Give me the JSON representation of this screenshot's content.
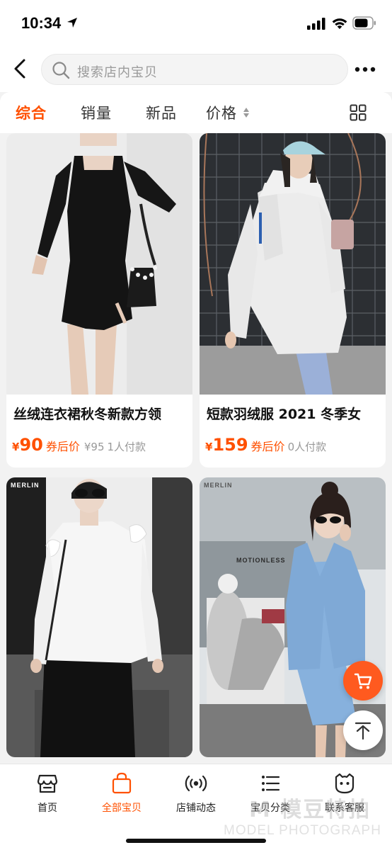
{
  "status_bar": {
    "time": "10:34",
    "icons": [
      "location-arrow-icon",
      "signal-icon",
      "wifi-icon",
      "battery-icon"
    ]
  },
  "top_nav": {
    "back_icon": "chevron-left-icon",
    "search_placeholder": "搜索店内宝贝",
    "search_icon": "search-icon",
    "more_icon": "more-dots-icon"
  },
  "filter_tabs": [
    {
      "label": "综合",
      "active": true
    },
    {
      "label": "销量",
      "active": false
    },
    {
      "label": "新品",
      "active": false
    },
    {
      "label": "价格",
      "active": false,
      "icon": "sort-arrows-icon"
    }
  ],
  "layout_toggle_icon": "grid-view-icon",
  "products": [
    {
      "title": "丝绒连衣裙秋冬新款方领",
      "currency": "¥",
      "price": "90",
      "coupon_label": "券后价",
      "original_price": "¥95",
      "sales": "1人付款"
    },
    {
      "title": "短款羽绒服 2021 冬季女",
      "currency": "¥",
      "price": "159",
      "coupon_label": "券后价",
      "sales": "0人付款"
    },
    {
      "brand_tag": "MERLIN"
    },
    {
      "brand_tag": "MERLIN",
      "scene_text": "MOTIONLESS"
    }
  ],
  "floating_buttons": {
    "cart_icon": "cart-icon",
    "top_icon": "back-to-top-icon"
  },
  "bottom_nav": [
    {
      "label": "首页",
      "icon": "store-home-icon",
      "active": false
    },
    {
      "label": "全部宝贝",
      "icon": "shopping-bag-icon",
      "active": true
    },
    {
      "label": "店铺动态",
      "icon": "broadcast-icon",
      "active": false
    },
    {
      "label": "宝贝分类",
      "icon": "list-icon",
      "active": false
    },
    {
      "label": "联系客服",
      "icon": "service-face-icon",
      "active": false
    }
  ],
  "watermark": {
    "main": "M 模豆特拍",
    "sub": "MODEL PHOTOGRAPH"
  },
  "colors": {
    "accent": "#ff5000",
    "price": "#ff5000",
    "muted": "#999999",
    "page_bg": "#f2f2f2"
  }
}
